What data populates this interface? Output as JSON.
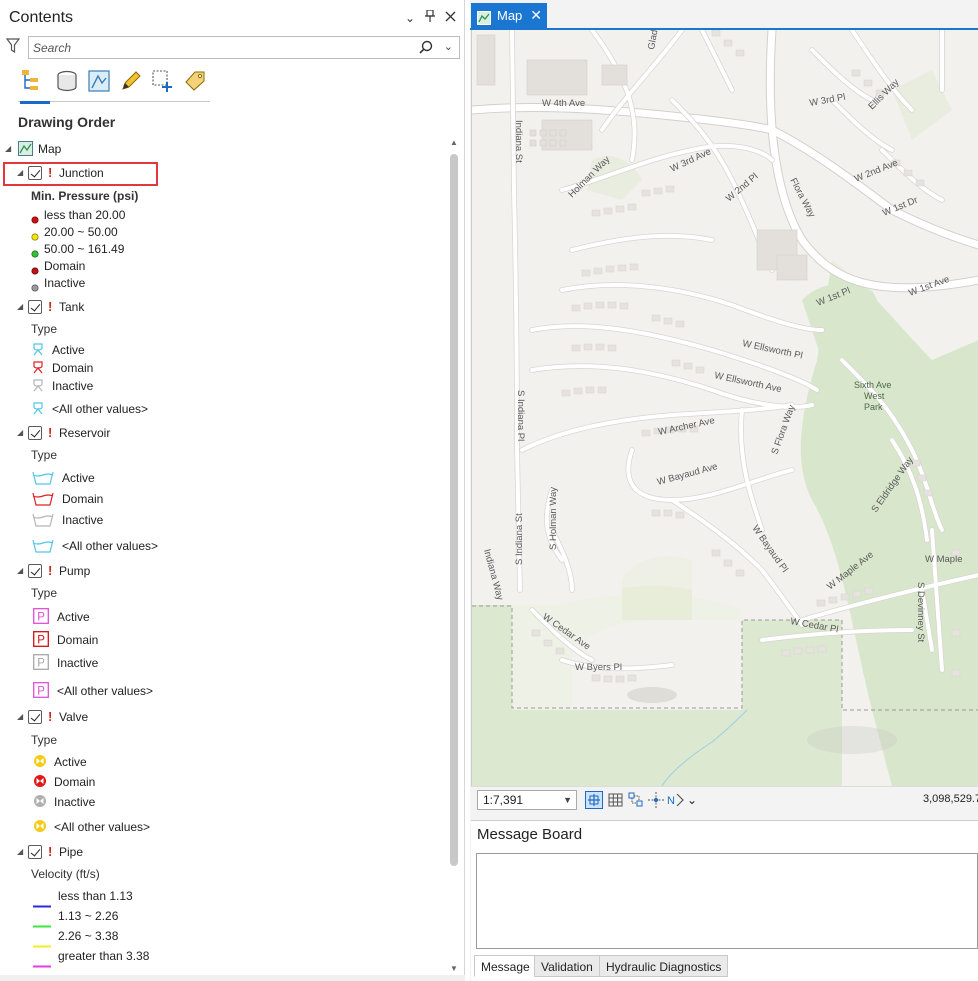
{
  "contents": {
    "title": "Contents",
    "search_placeholder": "Search",
    "heading": "Drawing Order",
    "map_label": "Map",
    "layers": {
      "junction": {
        "name": "Junction",
        "field": "Min. Pressure (psi)",
        "classes": [
          {
            "label": "less than 20.00",
            "color": "#d01010"
          },
          {
            "label": "20.00 ~ 50.00",
            "color": "#f5e400"
          },
          {
            "label": "50.00 ~ 161.49",
            "color": "#33c233"
          },
          {
            "label": "Domain",
            "color": "#c01010"
          },
          {
            "label": "Inactive",
            "color": "#9a9a9a"
          }
        ]
      },
      "tank": {
        "name": "Tank",
        "field": "Type",
        "classes": [
          {
            "label": "Active",
            "color": "#4fc6e8"
          },
          {
            "label": "Domain",
            "color": "#e02020"
          },
          {
            "label": "Inactive",
            "color": "#b5b5b5"
          },
          {
            "label": "<All other values>",
            "color": "#4fc6e8"
          }
        ]
      },
      "reservoir": {
        "name": "Reservoir",
        "field": "Type",
        "classes": [
          {
            "label": "Active",
            "color": "#4fc6e8"
          },
          {
            "label": "Domain",
            "color": "#e02020"
          },
          {
            "label": "Inactive",
            "color": "#b5b5b5"
          },
          {
            "label": "<All other values>",
            "color": "#4fc6e8"
          }
        ]
      },
      "pump": {
        "name": "Pump",
        "field": "Type",
        "classes": [
          {
            "label": "Active",
            "color": "#e14fd8"
          },
          {
            "label": "Domain",
            "color": "#d01010"
          },
          {
            "label": "Inactive",
            "color": "#a9a9a9"
          },
          {
            "label": "<All other values>",
            "color": "#e14fd8"
          }
        ]
      },
      "valve": {
        "name": "Valve",
        "field": "Type",
        "classes": [
          {
            "label": "Active",
            "color": "#f4cc18"
          },
          {
            "label": "Domain",
            "color": "#e01818"
          },
          {
            "label": "Inactive",
            "color": "#b0b0b0"
          },
          {
            "label": "<All other values>",
            "color": "#f4cc18"
          }
        ]
      },
      "pipe": {
        "name": "Pipe",
        "field": "Velocity (ft/s)",
        "classes": [
          {
            "label": "less than 1.13",
            "color": "#2a2ae6"
          },
          {
            "label": "1.13 ~ 2.26",
            "color": "#3ee63e"
          },
          {
            "label": "2.26 ~ 3.38",
            "color": "#f0f020"
          },
          {
            "label": "greater than 3.38",
            "color": "#e23ee2"
          }
        ]
      }
    }
  },
  "map": {
    "tab_label": "Map",
    "scale": "1:7,391",
    "coordinates": "3,098,529.7",
    "labels": {
      "w4th": "W 4th Ave",
      "w3rdpl": "W 3rd Pl",
      "ellis": "Ellis Way",
      "indiana": "Indiana St",
      "holman": "Holman Way",
      "w3rdave": "W 3rd Ave",
      "w2ndpl": "W 2nd Pl",
      "flora": "Flora Way",
      "w2ndave": "W 2nd Ave",
      "w1stdr": "W 1st Dr",
      "w1stpl": "W 1st Pl",
      "w1stave": "W 1st Ave",
      "ellsworthpl": "W Ellsworth Pl",
      "ellsworthave": "W Ellsworth Ave",
      "sindianapl": "S Indiana Pl",
      "archer": "W Archer Ave",
      "sflora": "S Flora Way",
      "bayaudave": "W Bayaud Ave",
      "seldridge": "S Eldridge Way",
      "sholman": "S Holman Way",
      "sindianast": "S Indiana St",
      "indianaway": "Indiana Way",
      "bayaudpl": "W Bayaud Pl",
      "maple": "W Maple Ave",
      "maple2": "W Maple",
      "cedarave": "W Cedar Ave",
      "cedarpl": "W Cedar Pl",
      "sdevinney": "S Devinney St",
      "byers": "W Byers Pl",
      "glad": "Glad",
      "park1": "Sixth Ave",
      "park2": "West",
      "park3": "Park"
    }
  },
  "message_board": {
    "title": "Message Board",
    "tabs": [
      "Message",
      "Validation",
      "Hydraulic Diagnostics"
    ]
  }
}
